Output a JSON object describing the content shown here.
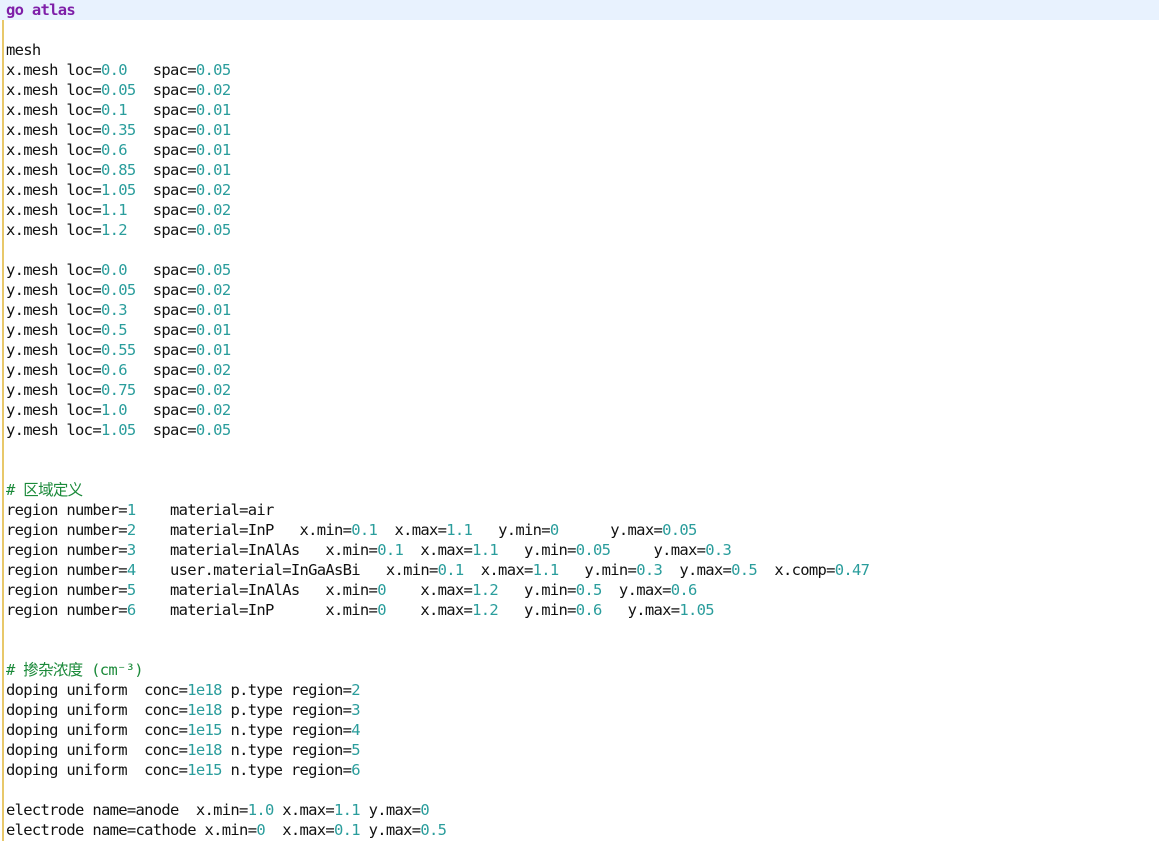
{
  "editor": {
    "colors": {
      "keyword": "#7f1fa8",
      "number": "#2a9d9c",
      "comment": "#1b8a3a",
      "text": "#111111",
      "current_line": "#e8f2fe",
      "gutter_marker": "#e8c86a"
    },
    "current_line_index": 0,
    "lines": [
      [
        {
          "t": "kw",
          "v": "go atlas"
        }
      ],
      [],
      [
        {
          "t": "txt",
          "v": "mesh"
        }
      ],
      [
        {
          "t": "txt",
          "v": "x.mesh loc="
        },
        {
          "t": "num",
          "v": "0.0"
        },
        {
          "t": "txt",
          "v": "   spac="
        },
        {
          "t": "num",
          "v": "0.05"
        }
      ],
      [
        {
          "t": "txt",
          "v": "x.mesh loc="
        },
        {
          "t": "num",
          "v": "0.05"
        },
        {
          "t": "txt",
          "v": "  spac="
        },
        {
          "t": "num",
          "v": "0.02"
        }
      ],
      [
        {
          "t": "txt",
          "v": "x.mesh loc="
        },
        {
          "t": "num",
          "v": "0.1"
        },
        {
          "t": "txt",
          "v": "   spac="
        },
        {
          "t": "num",
          "v": "0.01"
        }
      ],
      [
        {
          "t": "txt",
          "v": "x.mesh loc="
        },
        {
          "t": "num",
          "v": "0.35"
        },
        {
          "t": "txt",
          "v": "  spac="
        },
        {
          "t": "num",
          "v": "0.01"
        }
      ],
      [
        {
          "t": "txt",
          "v": "x.mesh loc="
        },
        {
          "t": "num",
          "v": "0.6"
        },
        {
          "t": "txt",
          "v": "   spac="
        },
        {
          "t": "num",
          "v": "0.01"
        }
      ],
      [
        {
          "t": "txt",
          "v": "x.mesh loc="
        },
        {
          "t": "num",
          "v": "0.85"
        },
        {
          "t": "txt",
          "v": "  spac="
        },
        {
          "t": "num",
          "v": "0.01"
        }
      ],
      [
        {
          "t": "txt",
          "v": "x.mesh loc="
        },
        {
          "t": "num",
          "v": "1.05"
        },
        {
          "t": "txt",
          "v": "  spac="
        },
        {
          "t": "num",
          "v": "0.02"
        }
      ],
      [
        {
          "t": "txt",
          "v": "x.mesh loc="
        },
        {
          "t": "num",
          "v": "1.1"
        },
        {
          "t": "txt",
          "v": "   spac="
        },
        {
          "t": "num",
          "v": "0.02"
        }
      ],
      [
        {
          "t": "txt",
          "v": "x.mesh loc="
        },
        {
          "t": "num",
          "v": "1.2"
        },
        {
          "t": "txt",
          "v": "   spac="
        },
        {
          "t": "num",
          "v": "0.05"
        }
      ],
      [],
      [
        {
          "t": "txt",
          "v": "y.mesh loc="
        },
        {
          "t": "num",
          "v": "0.0"
        },
        {
          "t": "txt",
          "v": "   spac="
        },
        {
          "t": "num",
          "v": "0.05"
        }
      ],
      [
        {
          "t": "txt",
          "v": "y.mesh loc="
        },
        {
          "t": "num",
          "v": "0.05"
        },
        {
          "t": "txt",
          "v": "  spac="
        },
        {
          "t": "num",
          "v": "0.02"
        }
      ],
      [
        {
          "t": "txt",
          "v": "y.mesh loc="
        },
        {
          "t": "num",
          "v": "0.3"
        },
        {
          "t": "txt",
          "v": "   spac="
        },
        {
          "t": "num",
          "v": "0.01"
        }
      ],
      [
        {
          "t": "txt",
          "v": "y.mesh loc="
        },
        {
          "t": "num",
          "v": "0.5"
        },
        {
          "t": "txt",
          "v": "   spac="
        },
        {
          "t": "num",
          "v": "0.01"
        }
      ],
      [
        {
          "t": "txt",
          "v": "y.mesh loc="
        },
        {
          "t": "num",
          "v": "0.55"
        },
        {
          "t": "txt",
          "v": "  spac="
        },
        {
          "t": "num",
          "v": "0.01"
        }
      ],
      [
        {
          "t": "txt",
          "v": "y.mesh loc="
        },
        {
          "t": "num",
          "v": "0.6"
        },
        {
          "t": "txt",
          "v": "   spac="
        },
        {
          "t": "num",
          "v": "0.02"
        }
      ],
      [
        {
          "t": "txt",
          "v": "y.mesh loc="
        },
        {
          "t": "num",
          "v": "0.75"
        },
        {
          "t": "txt",
          "v": "  spac="
        },
        {
          "t": "num",
          "v": "0.02"
        }
      ],
      [
        {
          "t": "txt",
          "v": "y.mesh loc="
        },
        {
          "t": "num",
          "v": "1.0"
        },
        {
          "t": "txt",
          "v": "   spac="
        },
        {
          "t": "num",
          "v": "0.02"
        }
      ],
      [
        {
          "t": "txt",
          "v": "y.mesh loc="
        },
        {
          "t": "num",
          "v": "1.05"
        },
        {
          "t": "txt",
          "v": "  spac="
        },
        {
          "t": "num",
          "v": "0.05"
        }
      ],
      [],
      [],
      [
        {
          "t": "com",
          "v": "# 区域定义"
        }
      ],
      [
        {
          "t": "txt",
          "v": "region number="
        },
        {
          "t": "num",
          "v": "1"
        },
        {
          "t": "txt",
          "v": "    material=air"
        }
      ],
      [
        {
          "t": "txt",
          "v": "region number="
        },
        {
          "t": "num",
          "v": "2"
        },
        {
          "t": "txt",
          "v": "    material=InP   x.min="
        },
        {
          "t": "num",
          "v": "0.1"
        },
        {
          "t": "txt",
          "v": "  x.max="
        },
        {
          "t": "num",
          "v": "1.1"
        },
        {
          "t": "txt",
          "v": "   y.min="
        },
        {
          "t": "num",
          "v": "0"
        },
        {
          "t": "txt",
          "v": "      y.max="
        },
        {
          "t": "num",
          "v": "0.05"
        }
      ],
      [
        {
          "t": "txt",
          "v": "region number="
        },
        {
          "t": "num",
          "v": "3"
        },
        {
          "t": "txt",
          "v": "    material=InAlAs   x.min="
        },
        {
          "t": "num",
          "v": "0.1"
        },
        {
          "t": "txt",
          "v": "  x.max="
        },
        {
          "t": "num",
          "v": "1.1"
        },
        {
          "t": "txt",
          "v": "   y.min="
        },
        {
          "t": "num",
          "v": "0.05"
        },
        {
          "t": "txt",
          "v": "     y.max="
        },
        {
          "t": "num",
          "v": "0.3"
        }
      ],
      [
        {
          "t": "txt",
          "v": "region number="
        },
        {
          "t": "num",
          "v": "4"
        },
        {
          "t": "txt",
          "v": "    user.material=InGaAsBi   x.min="
        },
        {
          "t": "num",
          "v": "0.1"
        },
        {
          "t": "txt",
          "v": "  x.max="
        },
        {
          "t": "num",
          "v": "1.1"
        },
        {
          "t": "txt",
          "v": "   y.min="
        },
        {
          "t": "num",
          "v": "0.3"
        },
        {
          "t": "txt",
          "v": "  y.max="
        },
        {
          "t": "num",
          "v": "0.5"
        },
        {
          "t": "txt",
          "v": "  x.comp="
        },
        {
          "t": "num",
          "v": "0.47"
        }
      ],
      [
        {
          "t": "txt",
          "v": "region number="
        },
        {
          "t": "num",
          "v": "5"
        },
        {
          "t": "txt",
          "v": "    material=InAlAs   x.min="
        },
        {
          "t": "num",
          "v": "0"
        },
        {
          "t": "txt",
          "v": "    x.max="
        },
        {
          "t": "num",
          "v": "1.2"
        },
        {
          "t": "txt",
          "v": "   y.min="
        },
        {
          "t": "num",
          "v": "0.5"
        },
        {
          "t": "txt",
          "v": "  y.max="
        },
        {
          "t": "num",
          "v": "0.6"
        }
      ],
      [
        {
          "t": "txt",
          "v": "region number="
        },
        {
          "t": "num",
          "v": "6"
        },
        {
          "t": "txt",
          "v": "    material=InP      x.min="
        },
        {
          "t": "num",
          "v": "0"
        },
        {
          "t": "txt",
          "v": "    x.max="
        },
        {
          "t": "num",
          "v": "1.2"
        },
        {
          "t": "txt",
          "v": "   y.min="
        },
        {
          "t": "num",
          "v": "0.6"
        },
        {
          "t": "txt",
          "v": "   y.max="
        },
        {
          "t": "num",
          "v": "1.05"
        }
      ],
      [],
      [],
      [
        {
          "t": "com",
          "v": "# 掺杂浓度 (cm⁻³)"
        }
      ],
      [
        {
          "t": "txt",
          "v": "doping uniform  conc="
        },
        {
          "t": "num",
          "v": "1e18"
        },
        {
          "t": "txt",
          "v": " p.type region="
        },
        {
          "t": "num",
          "v": "2"
        }
      ],
      [
        {
          "t": "txt",
          "v": "doping uniform  conc="
        },
        {
          "t": "num",
          "v": "1e18"
        },
        {
          "t": "txt",
          "v": " p.type region="
        },
        {
          "t": "num",
          "v": "3"
        }
      ],
      [
        {
          "t": "txt",
          "v": "doping uniform  conc="
        },
        {
          "t": "num",
          "v": "1e15"
        },
        {
          "t": "txt",
          "v": " n.type region="
        },
        {
          "t": "num",
          "v": "4"
        }
      ],
      [
        {
          "t": "txt",
          "v": "doping uniform  conc="
        },
        {
          "t": "num",
          "v": "1e18"
        },
        {
          "t": "txt",
          "v": " n.type region="
        },
        {
          "t": "num",
          "v": "5"
        }
      ],
      [
        {
          "t": "txt",
          "v": "doping uniform  conc="
        },
        {
          "t": "num",
          "v": "1e15"
        },
        {
          "t": "txt",
          "v": " n.type region="
        },
        {
          "t": "num",
          "v": "6"
        }
      ],
      [],
      [
        {
          "t": "txt",
          "v": "electrode name=anode  x.min="
        },
        {
          "t": "num",
          "v": "1.0"
        },
        {
          "t": "txt",
          "v": " x.max="
        },
        {
          "t": "num",
          "v": "1.1"
        },
        {
          "t": "txt",
          "v": " y.max="
        },
        {
          "t": "num",
          "v": "0"
        }
      ],
      [
        {
          "t": "txt",
          "v": "electrode name=cathode x.min="
        },
        {
          "t": "num",
          "v": "0"
        },
        {
          "t": "txt",
          "v": "  x.max="
        },
        {
          "t": "num",
          "v": "0.1"
        },
        {
          "t": "txt",
          "v": " y.max="
        },
        {
          "t": "num",
          "v": "0.5"
        }
      ]
    ]
  }
}
